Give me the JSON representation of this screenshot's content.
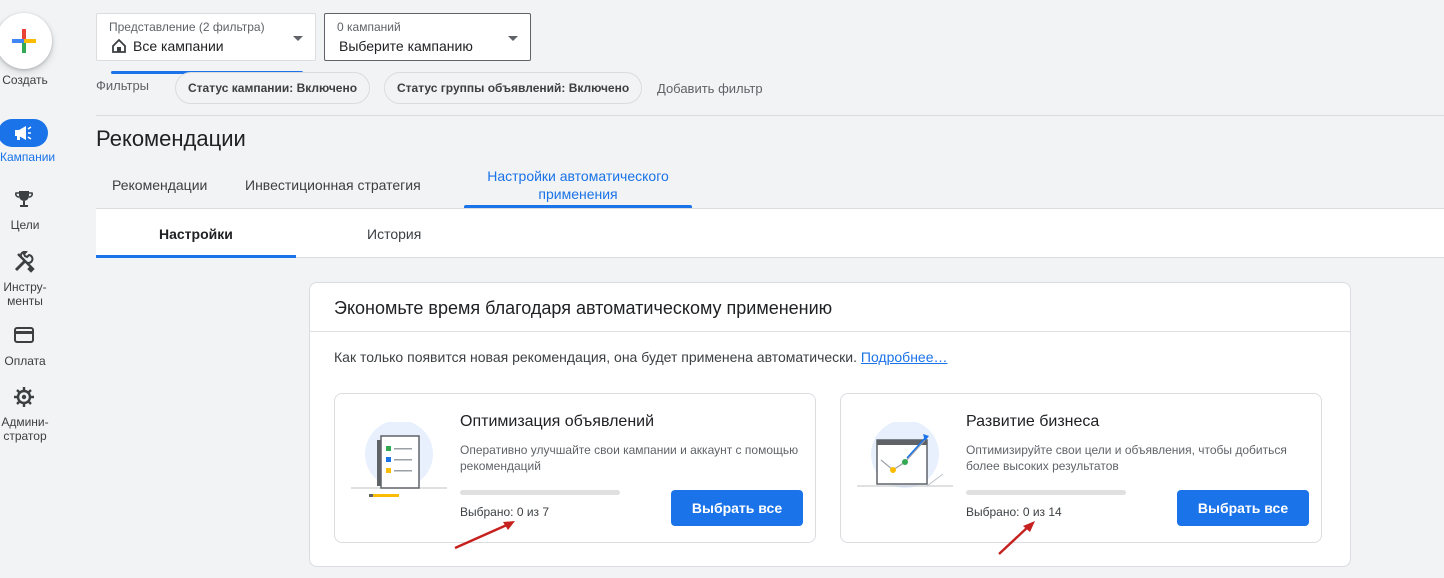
{
  "nav": {
    "create_label": "Создать",
    "items": [
      {
        "label": "Кампании",
        "icon": "megaphone-icon",
        "active": true
      },
      {
        "label": "Цели",
        "icon": "trophy-icon"
      },
      {
        "label_line1": "Инстру-",
        "label_line2": "менты",
        "icon": "tools-icon"
      },
      {
        "label": "Оплата",
        "icon": "credit-card-icon"
      },
      {
        "label_line1": "Админи-",
        "label_line2": "стратор",
        "icon": "gear-icon"
      }
    ]
  },
  "view_selector": {
    "small": "Представление (2 фильтра)",
    "value": "Все кампании"
  },
  "campaign_selector": {
    "small": "0 кампаний",
    "value": "Выберите кампанию"
  },
  "filters": {
    "label": "Фильтры",
    "chips": [
      "Статус кампании: Включено",
      "Статус группы объявлений: Включено"
    ],
    "add": "Добавить фильтр"
  },
  "page": {
    "title": "Рекомендации",
    "tabs": [
      {
        "label": "Рекомендации"
      },
      {
        "label": "Инвестиционная стратегия"
      },
      {
        "label_line1": "Настройки автоматического",
        "label_line2": "применения",
        "active": true
      }
    ],
    "subtabs": [
      {
        "label": "Настройки",
        "active": true
      },
      {
        "label": "История"
      }
    ]
  },
  "card": {
    "title": "Экономьте время благодаря автоматическому применению",
    "desc": "Как только появится новая рекомендация, она будет применена автоматически.",
    "link": "Подробнее…",
    "sections": [
      {
        "title": "Оптимизация объявлений",
        "desc": "Оперативно улучшайте свои кампании и аккаунт с помощью рекомендаций",
        "selected": "Выбрано: 0 из 7",
        "progress": 0,
        "button": "Выбрать все"
      },
      {
        "title": "Развитие бизнеса",
        "desc": "Оптимизируйте свои цели и объявления, чтобы добиться более высоких результатов",
        "selected": "Выбрано: 0 из 14",
        "progress": 0,
        "button": "Выбрать все"
      }
    ]
  },
  "colors": {
    "accent": "#1a73e8",
    "annotation": "#c5221f"
  }
}
